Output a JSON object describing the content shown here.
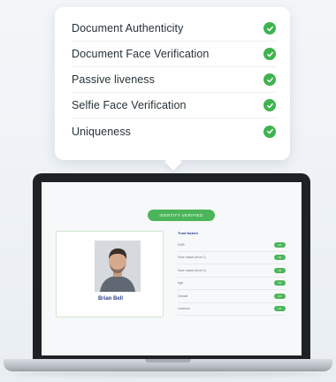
{
  "verification_checks": [
    {
      "label": "Document Authenticity"
    },
    {
      "label": "Document Face Verification"
    },
    {
      "label": "Passive liveness"
    },
    {
      "label": "Selfie Face Verification"
    },
    {
      "label": "Uniqueness"
    }
  ],
  "screen": {
    "status_pill": "IDENTITY VERIFIED",
    "profile_name": "Brian Bell",
    "trust_title": "Trust factors",
    "trust_factors": [
      {
        "label": "DOB",
        "badge": "OK"
      },
      {
        "label": "Face match (level 1)",
        "badge": "OK"
      },
      {
        "label": "Face match (level 2)",
        "badge": "OK"
      },
      {
        "label": "Age",
        "badge": "OK"
      },
      {
        "label": "Gender",
        "badge": "OK"
      },
      {
        "label": "Liveness",
        "badge": "OK"
      }
    ]
  },
  "colors": {
    "success": "#3fb34f",
    "name_text": "#2b3f8c",
    "laptop_bezel": "#1e2125"
  },
  "icons": {
    "check": "check-icon",
    "avatar": "user-photo"
  }
}
